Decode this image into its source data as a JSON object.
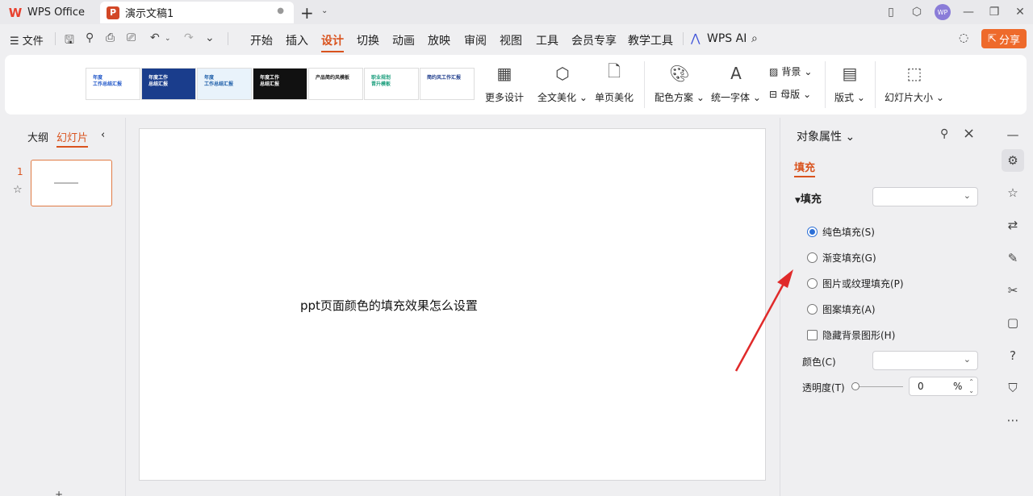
{
  "titlebar": {
    "app_tab_label": "WPS Office",
    "doc_tab_label": "演示文稿1",
    "avatar_label": "WP"
  },
  "menubar": {
    "file_label": "文件",
    "tabs": [
      "开始",
      "插入",
      "设计",
      "切换",
      "动画",
      "放映",
      "审阅",
      "视图",
      "工具",
      "会员专享",
      "教学工具"
    ],
    "active_tab": "设计",
    "wps_ai_label": "WPS AI",
    "share_label": "分享"
  },
  "ribbon": {
    "more_design": "更多设计",
    "full_beautify": "全文美化",
    "page_beautify": "单页美化",
    "color_scheme": "配色方案",
    "unify_font": "统一字体",
    "background": "背景",
    "master": "母版",
    "layout": "版式",
    "slide_size": "幻灯片大小",
    "thumbs": [
      {
        "line1": "年度",
        "line2": "工作总结汇报",
        "bg": "#ffffff",
        "fg": "#1f56c8"
      },
      {
        "line1": "年度工作",
        "line2": "总结汇报",
        "bg": "#1a3d8c",
        "fg": "#ffffff"
      },
      {
        "line1": "年度",
        "line2": "工作总结汇报",
        "bg": "#e9f3fb",
        "fg": "#1b5da8"
      },
      {
        "line1": "年度工作",
        "line2": "总结汇报",
        "bg": "#111111",
        "fg": "#ffffff"
      },
      {
        "line1": "产品简约风模板",
        "line2": "",
        "bg": "#ffffff",
        "fg": "#222222"
      },
      {
        "line1": "职业规划",
        "line2": "晋升模板",
        "bg": "#ffffff",
        "fg": "#1a9e7c"
      },
      {
        "line1": "简约风工作汇报",
        "line2": "",
        "bg": "#ffffff",
        "fg": "#1f3d8c"
      }
    ]
  },
  "leftpanel": {
    "outline_tab": "大纲",
    "slides_tab": "幻灯片",
    "slide_number": "1"
  },
  "slide": {
    "text": "ppt页面颜色的填充效果怎么设置"
  },
  "properties": {
    "title": "对象属性",
    "fill_tab": "填充",
    "fill_section": "填充",
    "options": {
      "solid": "纯色填充(S)",
      "gradient": "渐变填充(G)",
      "picture": "图片或纹理填充(P)",
      "pattern": "图案填充(A)",
      "hide_bg": "隐藏背景图形(H)"
    },
    "selected_option": "solid",
    "color_label": "颜色(C)",
    "transparency_label": "透明度(T)",
    "transparency_value": "0",
    "transparency_unit": "%"
  },
  "colors": {
    "accent": "#d9531e",
    "share": "#ee6a2b",
    "radio": "#2b6fd6",
    "arrow": "#e02a2a"
  },
  "icons": [
    "minus-icon",
    "properties-icon",
    "star-icon",
    "translate-icon",
    "brush-icon",
    "tools-icon",
    "book-icon",
    "help-icon",
    "shirt-icon",
    "more-icon"
  ]
}
